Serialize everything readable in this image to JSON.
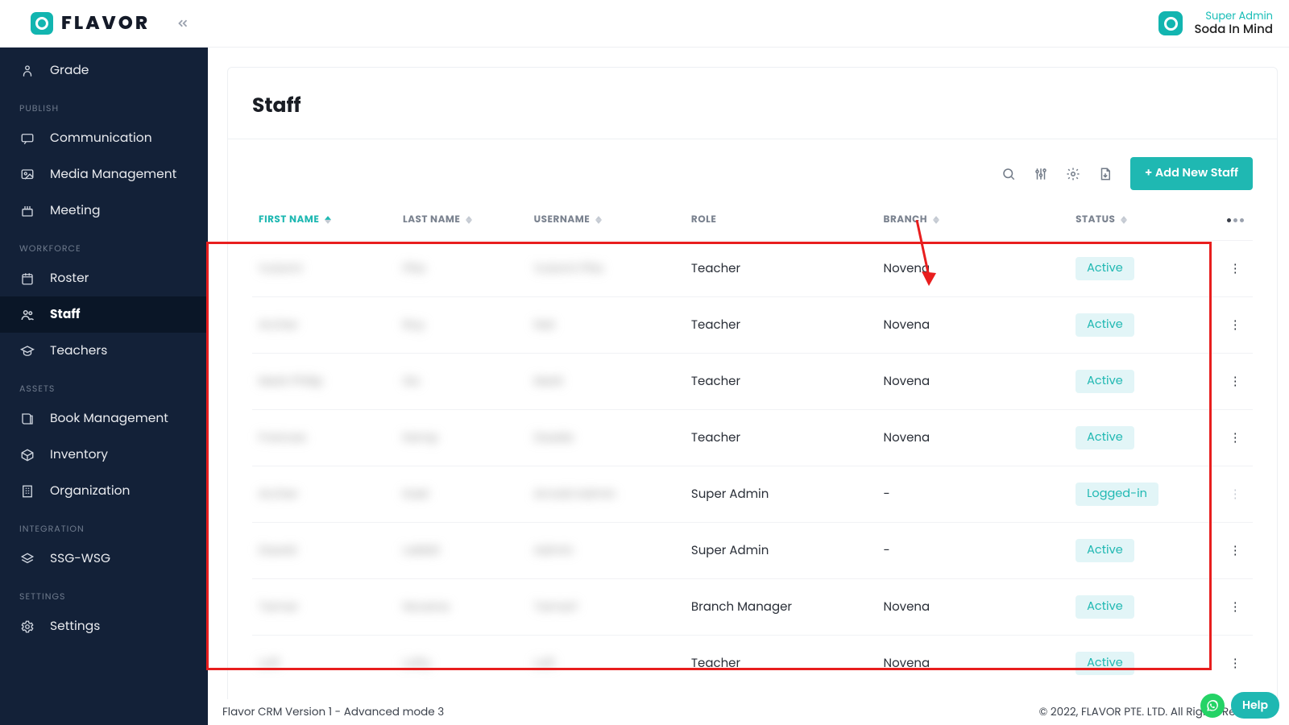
{
  "brand": {
    "name": "FLAVOR"
  },
  "header": {
    "role": "Super Admin",
    "company": "Soda In Mind"
  },
  "sidebar": {
    "top_item": "Grade",
    "sections": [
      {
        "label": "PUBLISH",
        "items": [
          "Communication",
          "Media Management",
          "Meeting"
        ]
      },
      {
        "label": "WORKFORCE",
        "items": [
          "Roster",
          "Staff",
          "Teachers"
        ]
      },
      {
        "label": "ASSETS",
        "items": [
          "Book Management",
          "Inventory",
          "Organization"
        ]
      },
      {
        "label": "INTEGRATION",
        "items": [
          "SSG-WSG"
        ]
      },
      {
        "label": "SETTINGS",
        "items": [
          "Settings"
        ]
      }
    ],
    "active": "Staff"
  },
  "page": {
    "title": "Staff",
    "add_button": "+ Add New Staff",
    "columns": [
      "FIRST NAME",
      "LAST NAME",
      "USERNAME",
      "ROLE",
      "BRANCH",
      "STATUS"
    ],
    "rows": [
      {
        "first": "Vutomi",
        "last": "Pita",
        "user": "Vutomi Pita",
        "role": "Teacher",
        "branch": "Novena",
        "status": "Active"
      },
      {
        "first": "Archer",
        "last": "Roy",
        "user": "Nat",
        "role": "Teacher",
        "branch": "Novena",
        "status": "Active"
      },
      {
        "first": "Mark Philip",
        "last": "Go",
        "user": "Mark",
        "role": "Teacher",
        "branch": "Novena",
        "status": "Active"
      },
      {
        "first": "Frances",
        "last": "Kemp",
        "user": "Dsada",
        "role": "Teacher",
        "branch": "Novena",
        "status": "Active"
      },
      {
        "first": "Archer",
        "last": "Kael",
        "user": "Arnold Admin",
        "role": "Super Admin",
        "branch": "-",
        "status": "Logged-in"
      },
      {
        "first": "Dawid",
        "last": "Labbit",
        "user": "Admin",
        "role": "Super Admin",
        "branch": "-",
        "status": "Active"
      },
      {
        "first": "Tamar",
        "last": "Novena",
        "user": "Tamar1",
        "role": "Branch Manager",
        "branch": "Novena",
        "status": "Active"
      },
      {
        "first": "Loft",
        "last": "Lofty",
        "user": "Loft",
        "role": "Teacher",
        "branch": "Novena",
        "status": "Active"
      }
    ]
  },
  "footer": {
    "version": "Flavor CRM Version 1 - Advanced mode 3",
    "copyright": "© 2022, FLAVOR PTE. LTD. All Rights Reserved."
  },
  "help": {
    "label": "Help"
  }
}
